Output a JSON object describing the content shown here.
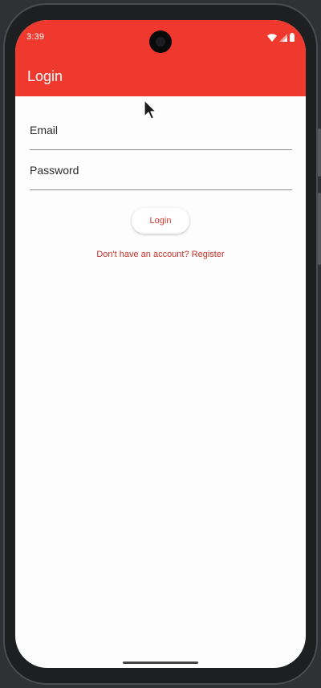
{
  "status_bar": {
    "time": "3:39",
    "icons": [
      "wifi-icon",
      "signal-icon",
      "battery-icon"
    ]
  },
  "app_bar": {
    "title": "Login"
  },
  "form": {
    "email_label": "Email",
    "password_label": "Password",
    "login_button_label": "Login",
    "register_link_text": "Don't have an account? Register"
  },
  "colors": {
    "primary": "#f0392e",
    "accent_text": "#d3362c",
    "background": "#fdfdfd"
  }
}
